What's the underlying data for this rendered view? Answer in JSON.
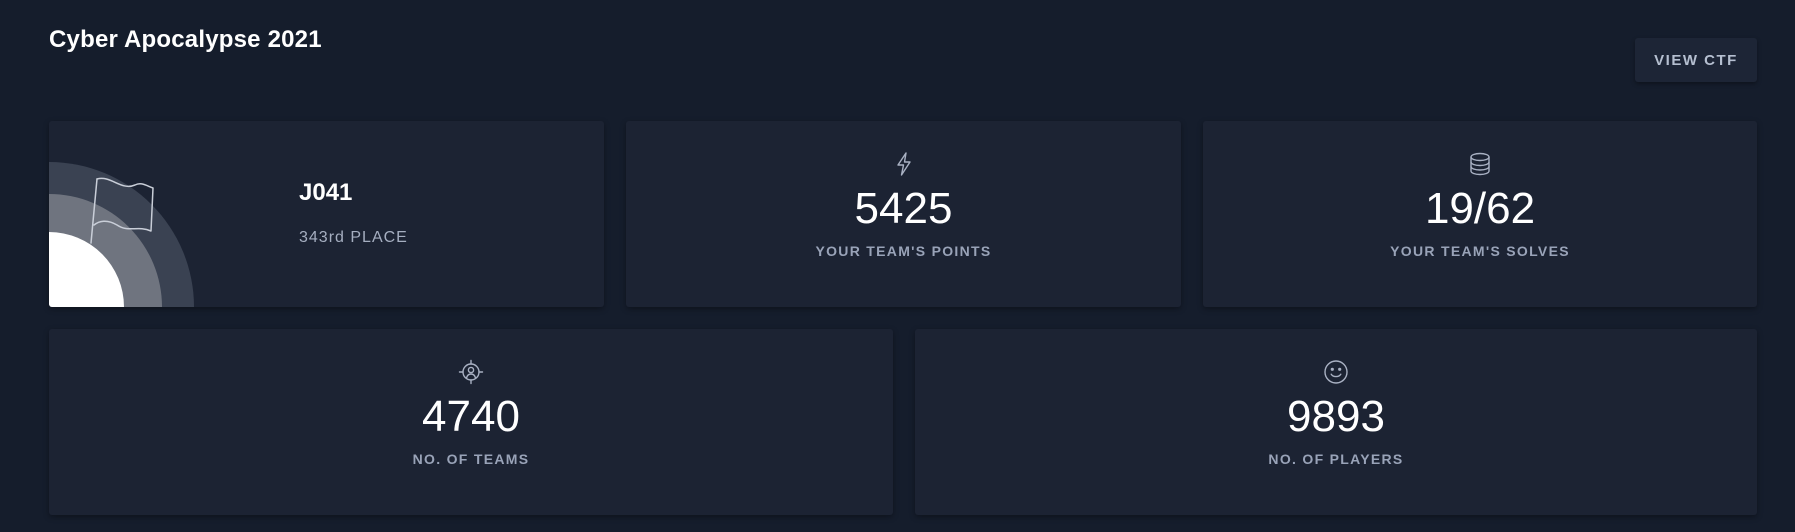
{
  "header": {
    "title": "Cyber Apocalypse 2021",
    "view_button_label": "VIEW CTF"
  },
  "team_card": {
    "name": "J041",
    "place": "343rd PLACE",
    "icon": "flag-icon"
  },
  "stats": {
    "points": {
      "value": "5425",
      "label": "YOUR TEAM'S POINTS",
      "icon": "lightning-icon"
    },
    "solves": {
      "value": "19/62",
      "label": "YOUR TEAM'S SOLVES",
      "icon": "database-icon"
    },
    "teams": {
      "value": "4740",
      "label": "NO. OF TEAMS",
      "icon": "target-user-icon"
    },
    "players": {
      "value": "9893",
      "label": "NO. OF PLAYERS",
      "icon": "smiley-icon"
    }
  },
  "colors": {
    "background": "#151d2c",
    "card": "#1c2333",
    "text_primary": "#ffffff",
    "text_secondary": "#99a3b8"
  }
}
